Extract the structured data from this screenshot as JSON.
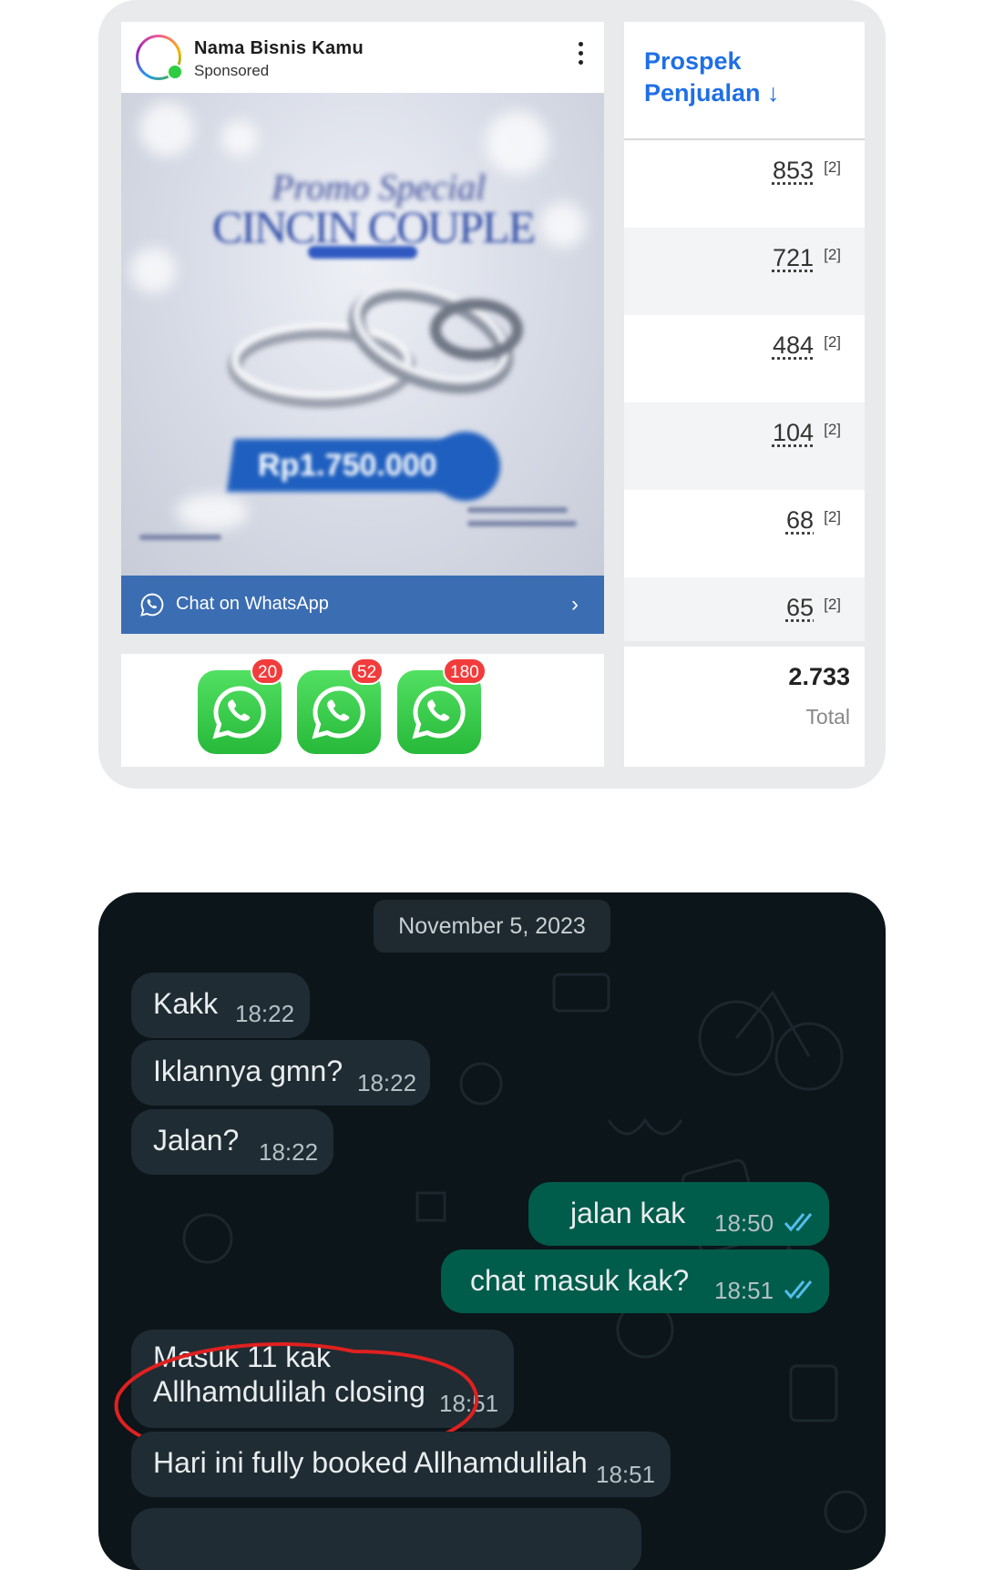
{
  "ad": {
    "business_name": "Nama Bisnis Kamu",
    "sponsored_label": "Sponsored",
    "image_title_script": "Promo Special",
    "image_title": "CINCIN COUPLE",
    "image_price": "Rp1.750.000",
    "cta_label": "Chat on WhatsApp"
  },
  "whatsapp_icons": [
    {
      "badge": "20"
    },
    {
      "badge": "52"
    },
    {
      "badge": "180"
    }
  ],
  "stats": {
    "title_line1": "Prospek",
    "title_line2": "Penjualan ↓",
    "rows": [
      {
        "value": "853",
        "ref": "[2]"
      },
      {
        "value": "721",
        "ref": "[2]"
      },
      {
        "value": "484",
        "ref": "[2]"
      },
      {
        "value": "104",
        "ref": "[2]"
      },
      {
        "value": "68",
        "ref": "[2]"
      },
      {
        "value": "65",
        "ref": "[2]"
      }
    ],
    "total_value": "2.733",
    "total_label": "Total"
  },
  "chat": {
    "date": "November 5, 2023",
    "messages": [
      {
        "text": "Kakk",
        "time": "18:22",
        "direction": "in"
      },
      {
        "text": "Iklannya gmn?",
        "time": "18:22",
        "direction": "in"
      },
      {
        "text": "Jalan?",
        "time": "18:22",
        "direction": "in"
      },
      {
        "text": "jalan kak",
        "time": "18:50",
        "direction": "out"
      },
      {
        "text": "chat masuk kak?",
        "time": "18:51",
        "direction": "out"
      },
      {
        "text": "Masuk 11 kak",
        "text2": "Allhamdulilah closing",
        "time": "18:51",
        "direction": "in"
      },
      {
        "text": "Hari ini fully booked Allhamdulilah",
        "time": "18:51",
        "direction": "in"
      }
    ]
  },
  "colors": {
    "accent_blue": "#1f6fe5",
    "cta_blue": "#3b6db3",
    "whatsapp_green": "#27b93a",
    "badge_red": "#f23c3c",
    "chat_bg": "#0c1519",
    "bubble_in": "#1f2c33",
    "bubble_out": "#005c4b",
    "highlight_red": "#e02020"
  }
}
